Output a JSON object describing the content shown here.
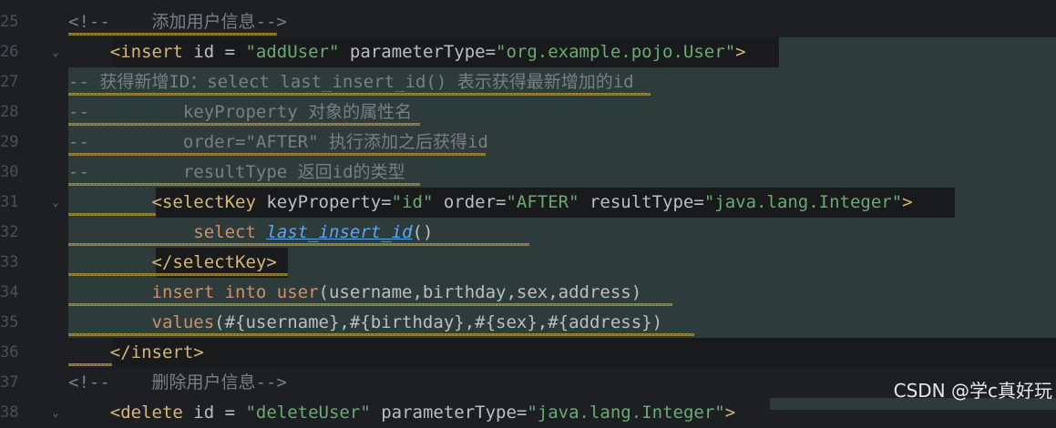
{
  "editor": {
    "lines": [
      {
        "num": "25",
        "fold": "",
        "tokens": [
          {
            "t": "<!--    添加用户信息-->",
            "c": "c-comment"
          }
        ]
      },
      {
        "num": "26",
        "fold": "⌄",
        "tokens": [
          {
            "t": "    ",
            "c": "c-plain"
          },
          {
            "t": "<insert",
            "c": "c-tag"
          },
          {
            "t": " id = ",
            "c": "c-attr"
          },
          {
            "t": "\"addUser\"",
            "c": "c-str"
          },
          {
            "t": " parameterType=",
            "c": "c-attr"
          },
          {
            "t": "\"org.example.pojo.User\"",
            "c": "c-str"
          },
          {
            "t": ">",
            "c": "c-tag"
          }
        ]
      },
      {
        "num": "27",
        "fold": "",
        "tokens": [
          {
            "t": "-- 获得新增ID：select last_insert_id() 表示获得最新增加的id",
            "c": "c-comment"
          }
        ]
      },
      {
        "num": "28",
        "fold": "",
        "tokens": [
          {
            "t": "--         keyProperty 对象的属性名",
            "c": "c-comment"
          }
        ]
      },
      {
        "num": "29",
        "fold": "",
        "tokens": [
          {
            "t": "--         order=\"AFTER\" 执行添加之后获得id",
            "c": "c-comment"
          }
        ]
      },
      {
        "num": "30",
        "fold": "",
        "tokens": [
          {
            "t": "--         resultType 返回id的类型",
            "c": "c-comment"
          }
        ]
      },
      {
        "num": "31",
        "fold": "⌄",
        "tokens": [
          {
            "t": "        ",
            "c": "c-plain"
          },
          {
            "t": "<selectKey",
            "c": "c-tag"
          },
          {
            "t": " keyProperty=",
            "c": "c-attr"
          },
          {
            "t": "\"id\"",
            "c": "c-str"
          },
          {
            "t": " order=",
            "c": "c-attr"
          },
          {
            "t": "\"AFTER\"",
            "c": "c-str"
          },
          {
            "t": " resultType=",
            "c": "c-attr"
          },
          {
            "t": "\"java.lang.Integer\"",
            "c": "c-str"
          },
          {
            "t": ">",
            "c": "c-tag"
          }
        ]
      },
      {
        "num": "32",
        "fold": "",
        "tokens": [
          {
            "t": "            ",
            "c": "c-plain"
          },
          {
            "t": "select",
            "c": "c-kw"
          },
          {
            "t": " ",
            "c": "c-plain"
          },
          {
            "t": "last_insert_id",
            "c": "c-fn"
          },
          {
            "t": "()",
            "c": "c-plain"
          }
        ]
      },
      {
        "num": "33",
        "fold": "",
        "tokens": [
          {
            "t": "        ",
            "c": "c-plain"
          },
          {
            "t": "</selectKey>",
            "c": "c-tag"
          }
        ]
      },
      {
        "num": "34",
        "fold": "",
        "tokens": [
          {
            "t": "        ",
            "c": "c-plain"
          },
          {
            "t": "insert into user",
            "c": "c-kw"
          },
          {
            "t": "(username,birthday,sex,address)",
            "c": "c-plain"
          }
        ]
      },
      {
        "num": "35",
        "fold": "",
        "tokens": [
          {
            "t": "        ",
            "c": "c-plain"
          },
          {
            "t": "values",
            "c": "c-kw"
          },
          {
            "t": "(#{username},#{birthday},#{sex},#{address})",
            "c": "c-plain"
          }
        ]
      },
      {
        "num": "36",
        "fold": "",
        "tokens": [
          {
            "t": "    ",
            "c": "c-plain"
          },
          {
            "t": "</insert>",
            "c": "c-tag"
          }
        ]
      },
      {
        "num": "37",
        "fold": "",
        "tokens": [
          {
            "t": "<!--    删除用户信息-->",
            "c": "c-comment"
          }
        ]
      },
      {
        "num": "38",
        "fold": "⌄",
        "tokens": [
          {
            "t": "    ",
            "c": "c-plain"
          },
          {
            "t": "<delete",
            "c": "c-tag"
          },
          {
            "t": " id = ",
            "c": "c-attr"
          },
          {
            "t": "\"deleteUser\"",
            "c": "c-str"
          },
          {
            "t": " parameterType=",
            "c": "c-attr"
          },
          {
            "t": "\"java.lang.Integer\"",
            "c": "c-str"
          },
          {
            "t": ">",
            "c": "c-tag"
          }
        ]
      }
    ]
  },
  "watermark": "CSDN @学c真好玩"
}
